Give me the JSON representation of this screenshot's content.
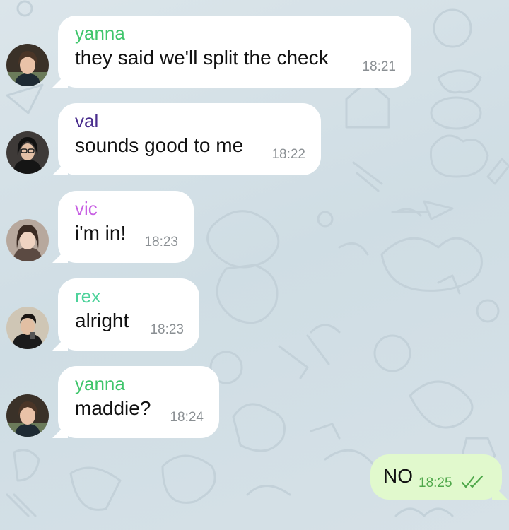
{
  "colors": {
    "incoming_bubble": "#ffffff",
    "outgoing_bubble": "#e1f9cd",
    "timestamp": "#8a8f93",
    "outgoing_timestamp": "#4fa84a"
  },
  "messages": [
    {
      "sender": "yanna",
      "sender_color": "#3fc56b",
      "text": "they said we'll split the check",
      "time": "18:21"
    },
    {
      "sender": "val",
      "sender_color": "#4a2e8e",
      "text": "sounds good to me",
      "time": "18:22"
    },
    {
      "sender": "vic",
      "sender_color": "#c862e3",
      "text": "i'm in!",
      "time": "18:23"
    },
    {
      "sender": "rex",
      "sender_color": "#4cd29a",
      "text": "alright",
      "time": "18:23"
    },
    {
      "sender": "yanna",
      "sender_color": "#3fc56b",
      "text": "maddie?",
      "time": "18:24"
    }
  ],
  "outgoing": {
    "text": "NO",
    "time": "18:25",
    "status_icon": "double-check-icon"
  }
}
